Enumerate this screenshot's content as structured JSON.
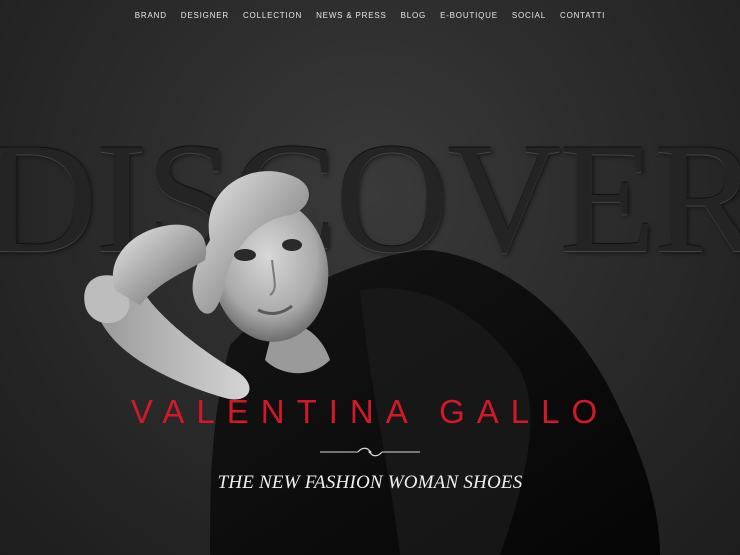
{
  "nav": {
    "items": [
      "BRAND",
      "DESIGNER",
      "COLLECTION",
      "NEWS & PRESS",
      "BLOG",
      "E-BOUTIQUE",
      "SOCIAL",
      "CONTATTI"
    ]
  },
  "hero": {
    "background_word": "DISCOVER",
    "brand_name": "VALENTINA GALLO",
    "tagline": "THE NEW FASHION WOMAN SHOES",
    "portrait": "black-and-white portrait of woman with short hair resting head on hand"
  },
  "colors": {
    "background": "#2a2a2a",
    "accent_red": "#d1192a",
    "nav_text": "#e6e6e6"
  }
}
